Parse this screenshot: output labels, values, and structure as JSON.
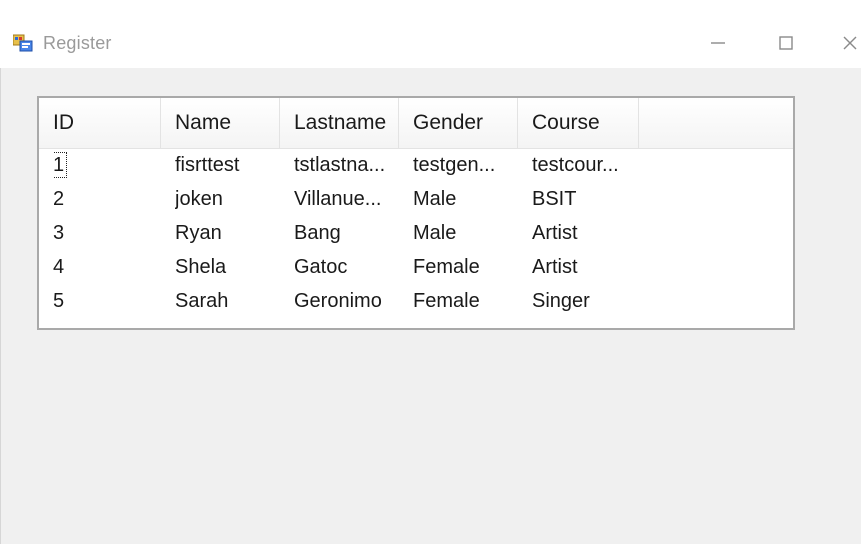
{
  "window": {
    "title": "Register"
  },
  "listview": {
    "columns": [
      "ID",
      "Name",
      "Lastname",
      "Gender",
      "Course"
    ],
    "rows": [
      [
        "1",
        "fisrttest",
        "tstlastna...",
        "testgen...",
        "testcour..."
      ],
      [
        "2",
        "joken",
        "Villanue...",
        "Male",
        "BSIT"
      ],
      [
        "3",
        "Ryan",
        "Bang",
        "Male",
        "Artist"
      ],
      [
        "4",
        "Shela",
        "Gatoc",
        "Female",
        "Artist"
      ],
      [
        "5",
        "Sarah",
        "Geronimo",
        "Female",
        "Singer"
      ]
    ],
    "focused_row": 0
  },
  "icons": {
    "app": "form-app-icon",
    "minimize": "minimize-icon",
    "maximize": "maximize-icon",
    "close": "close-icon"
  }
}
